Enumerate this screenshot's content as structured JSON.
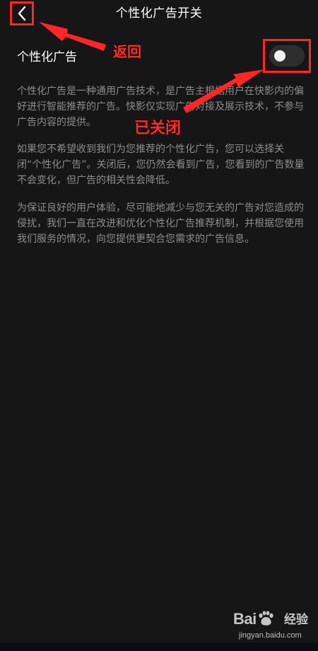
{
  "header": {
    "title": "个性化广告开关",
    "back_icon": "chevron-left-icon"
  },
  "setting": {
    "label": "个性化广告",
    "toggle_state": "off"
  },
  "descriptions": [
    "个性化广告是一种通用广告技术，是广告主根据用户在快影内的偏好进行智能推荐的广告。快影仅实现广告对接及展示技术，不参与广告内容的提供。",
    "如果您不希望收到我们为您推荐的个性化广告，您可以选择关闭“个性化广告”。关闭后，您仍然会看到广告，您看到的广告数量不会变化，但广告的相关性会降低。",
    "为保证良好的用户体验，尽可能地减少与您无关的广告对您造成的侵扰，我们一直在改进和优化个性化广告推荐机制，并根据您使用我们服务的情况，向您提供更契合您需求的广告信息。"
  ],
  "annotations": {
    "back": "返回",
    "closed": "已关闭"
  },
  "watermark": {
    "logo_left": "Bai",
    "logo_right": "经验",
    "url": "jingyan.baidu.com"
  },
  "colors": {
    "background": "#161616",
    "annotation_red": "#ff2626",
    "toggle_track_off": "#2e2e2e",
    "description_text": "#8c8c8c"
  }
}
